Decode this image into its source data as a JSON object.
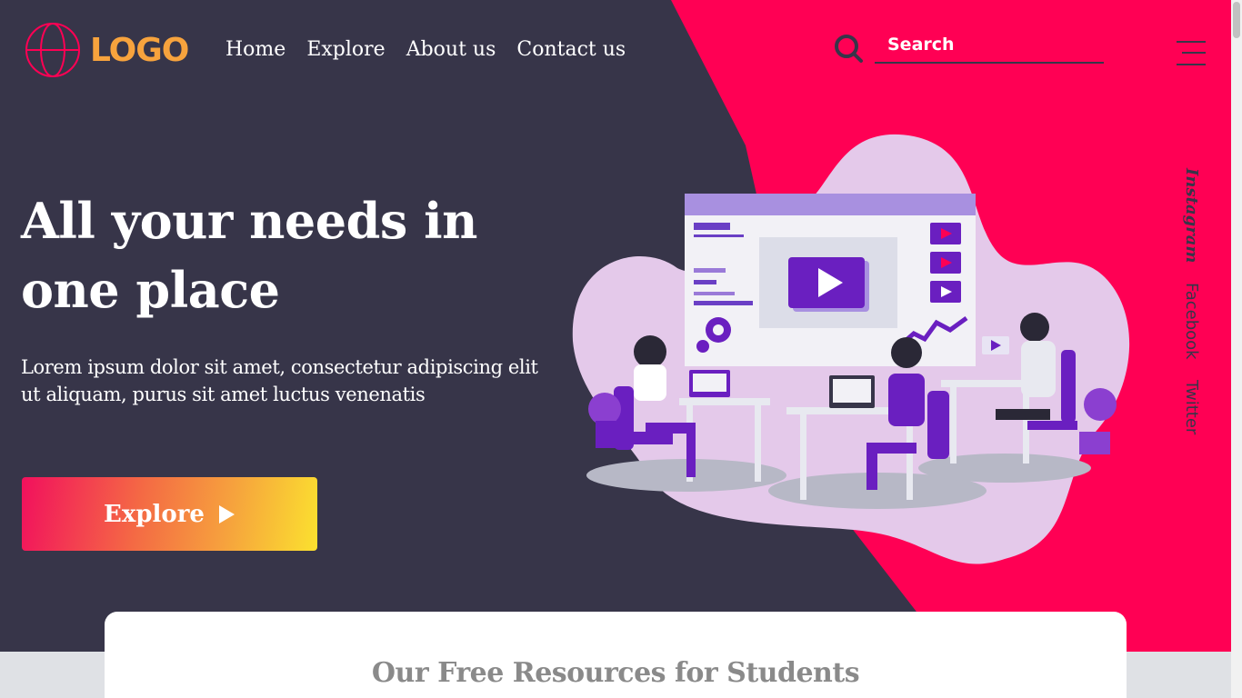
{
  "header": {
    "logo_text": "LOGO",
    "nav": [
      "Home",
      "Explore",
      "About us",
      "Contact us"
    ],
    "search_placeholder": "Search"
  },
  "hero": {
    "headline": "All your needs in one place",
    "subtext": "Lorem ipsum dolor sit amet, consectetur adipiscing elit ut aliquam, purus sit amet luctus venenatis",
    "cta_label": "Explore"
  },
  "social": [
    "Instagram",
    "Facebook",
    "Twitter"
  ],
  "resources": {
    "title": "Our Free Resources for Students"
  },
  "icons": [
    "globe-icon",
    "search-icon",
    "hamburger-menu-icon",
    "play-icon"
  ],
  "colors": {
    "dark_bg": "#373549",
    "accent_pink": "#ff0054",
    "logo_orange": "#f7a33d",
    "gradient_end": "#fbe12f"
  }
}
